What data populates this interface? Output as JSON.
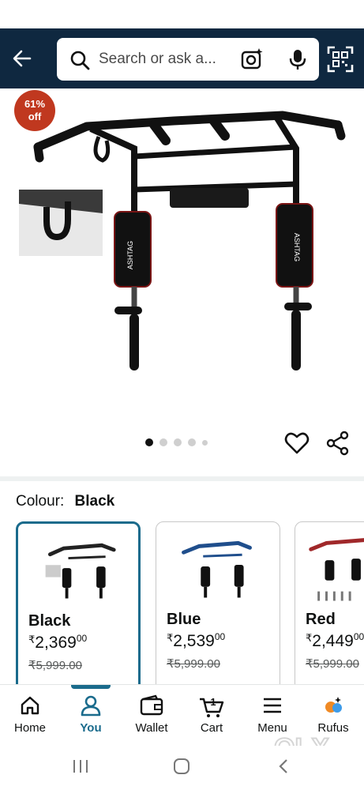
{
  "search": {
    "placeholder": "Search or ask a..."
  },
  "product": {
    "discount_badge": [
      "61%",
      "off"
    ],
    "image_count": 5,
    "active_image": 1
  },
  "colour": {
    "label": "Colour:",
    "selected": "Black",
    "options": [
      {
        "name": "Black",
        "currency": "₹",
        "price_main": "2,369",
        "price_paise": "00",
        "mrp": "₹5,999.00",
        "accent": "#222222"
      },
      {
        "name": "Blue",
        "currency": "₹",
        "price_main": "2,539",
        "price_paise": "00",
        "mrp": "₹5,999.00",
        "accent": "#1f4e8c"
      },
      {
        "name": "Red",
        "currency": "₹",
        "price_main": "2,449",
        "price_paise": "00",
        "mrp": "₹5,999.00",
        "accent": "#a0282a"
      }
    ]
  },
  "nav": {
    "items": [
      {
        "label": "Home",
        "icon": "home-icon"
      },
      {
        "label": "You",
        "icon": "user-icon",
        "active": true
      },
      {
        "label": "Wallet",
        "icon": "wallet-icon"
      },
      {
        "label": "Cart",
        "icon": "cart-icon",
        "badge": "1"
      },
      {
        "label": "Menu",
        "icon": "menu-icon"
      },
      {
        "label": "Rufus",
        "icon": "rufus-icon"
      }
    ]
  },
  "watermark": {
    "text": "OLX"
  },
  "colors": {
    "header_bg": "#0f2840",
    "accent": "#1a6b8c",
    "badge": "#c0381f"
  }
}
